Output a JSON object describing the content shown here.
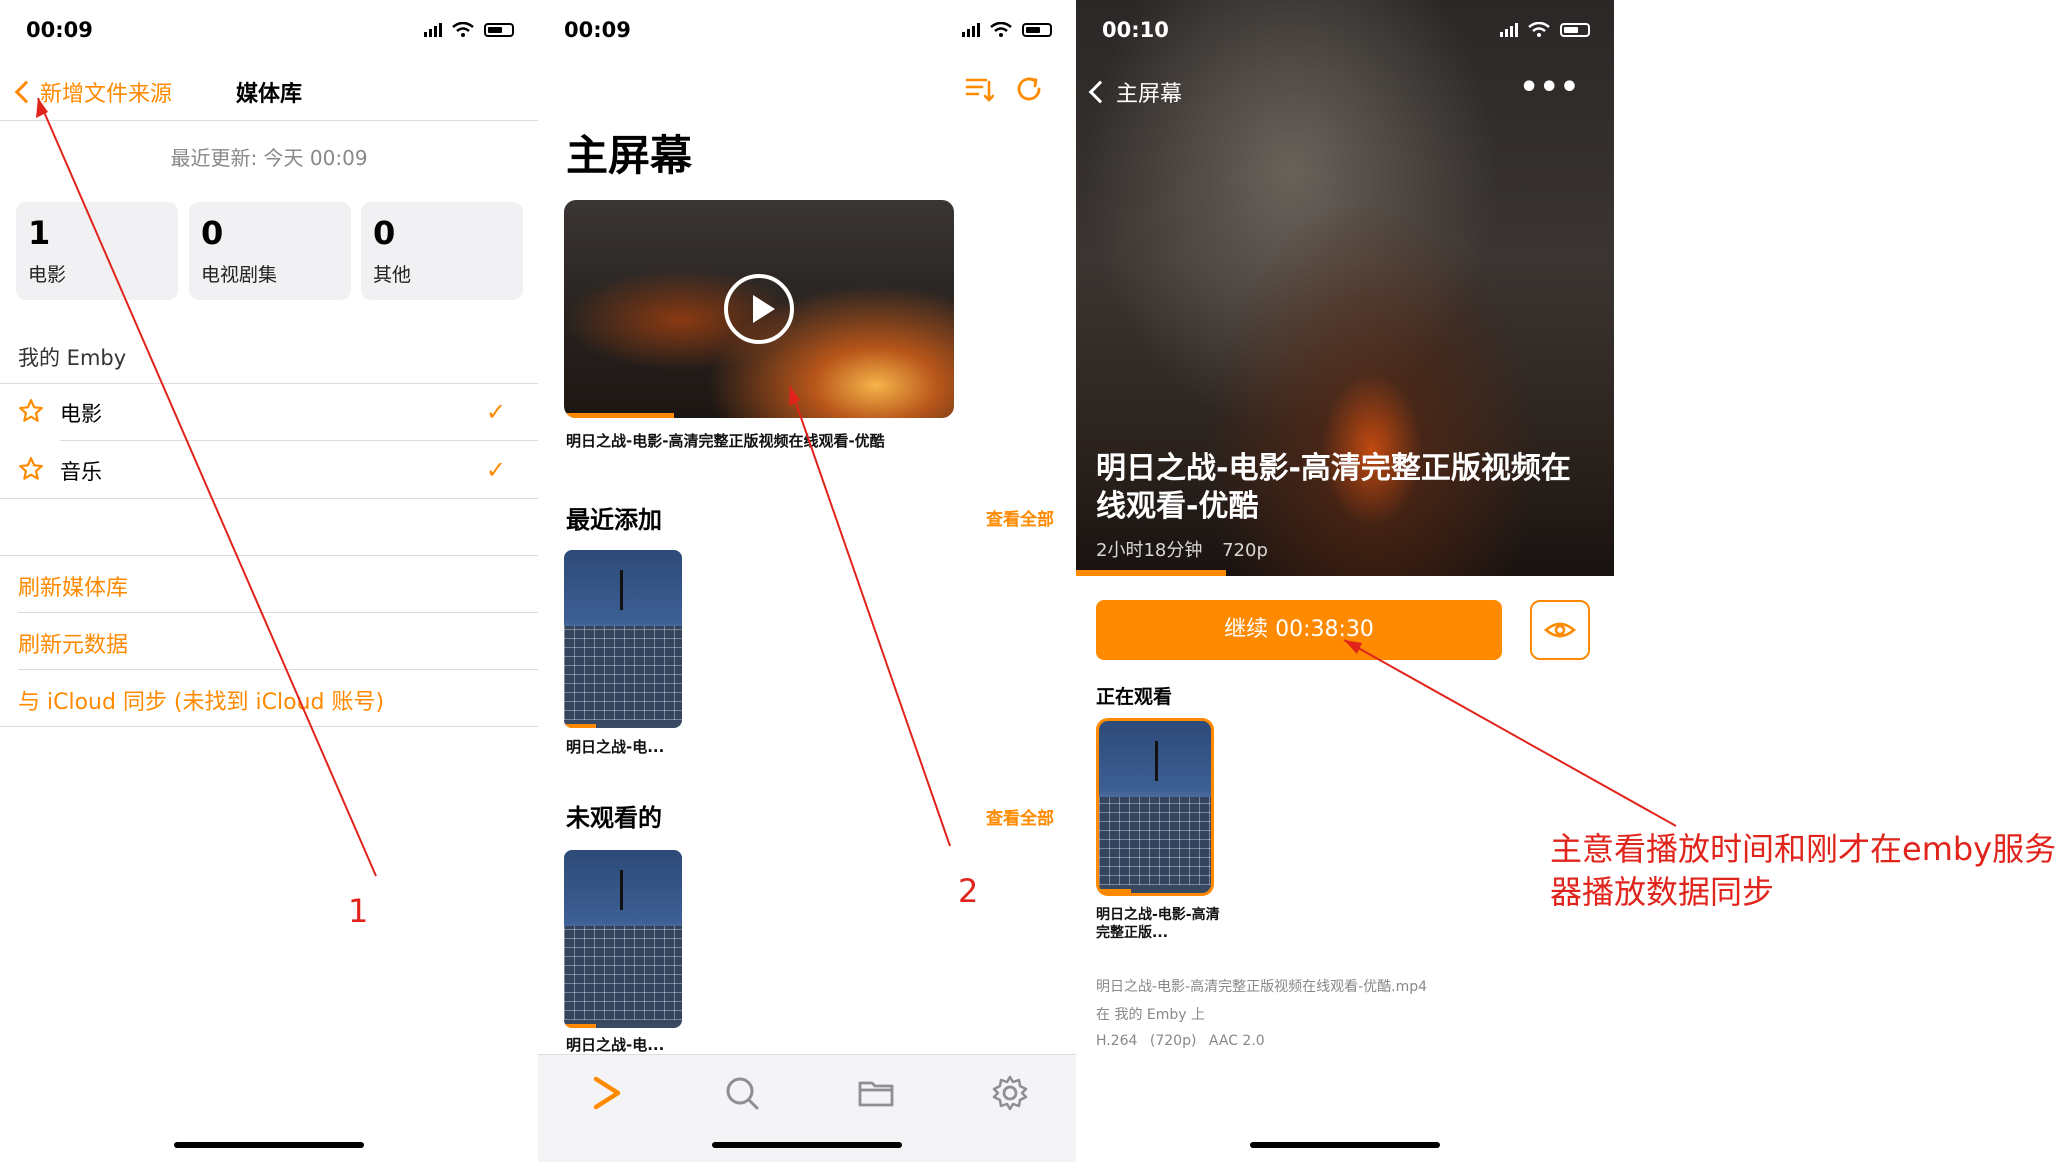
{
  "screen1": {
    "time": "00:09",
    "back_label": "新增文件来源",
    "title": "媒体库",
    "updated": "最近更新: 今天 00:09",
    "stats": [
      {
        "num": "1",
        "label": "电影"
      },
      {
        "num": "0",
        "label": "电视剧集"
      },
      {
        "num": "0",
        "label": "其他"
      }
    ],
    "section": "我的 Emby",
    "libraries": [
      {
        "label": "电影",
        "checked": true
      },
      {
        "label": "音乐",
        "checked": true
      }
    ],
    "actions": [
      "刷新媒体库",
      "刷新元数据",
      "与 iCloud 同步 (未找到 iCloud 账号)"
    ]
  },
  "screen2": {
    "time": "00:09",
    "title": "主屏幕",
    "hero_caption": "明日之战-电影-高清完整正版视频在线观看-优酷",
    "recent_title": "最近添加",
    "unwatched_title": "未观看的",
    "see_all": "查看全部",
    "item_caption": "明日之战-电...",
    "tabs": [
      "play-icon",
      "search-icon",
      "folder-icon",
      "gear-icon"
    ]
  },
  "screen3": {
    "time": "00:10",
    "back_label": "主屏幕",
    "movie_title": "明日之战-电影-高清完整正版视频在线观看-优酷",
    "duration": "2小时18分钟",
    "resolution": "720p",
    "continue_label": "继续 00:38:30",
    "watching_title": "正在观看",
    "watching_caption": "明日之战-电影-高清完整正版...",
    "file_name": "明日之战-电影-高清完整正版视频在线观看-优酷.mp4",
    "location": "在 我的 Emby 上",
    "codec": "H.264",
    "codec_res": "(720p)",
    "audio": "AAC 2.0"
  },
  "annotations": {
    "label1": "1",
    "label2": "2",
    "note": "主意看播放时间和刚才在emby服务器播放数据同步"
  },
  "colors": {
    "accent": "#ff8a00",
    "annotation": "#e0241c"
  }
}
